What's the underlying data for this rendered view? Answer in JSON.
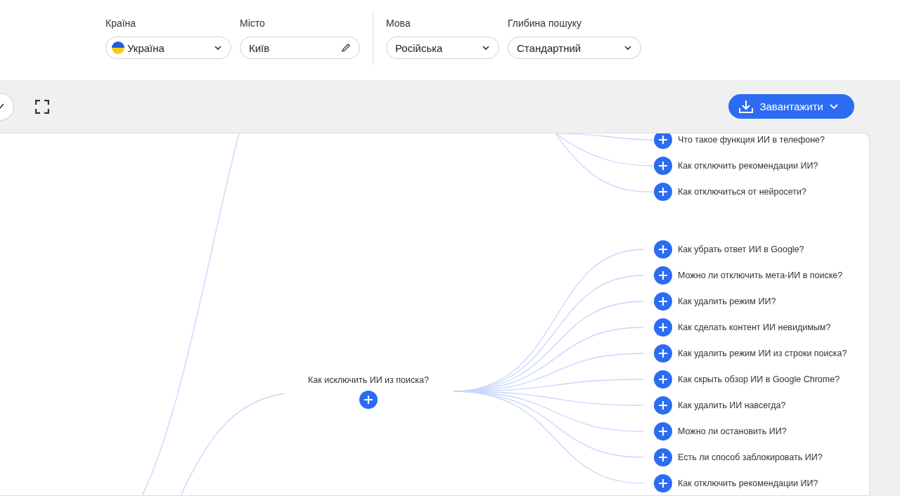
{
  "filters": [
    {
      "label": "Країна",
      "value": "Україна",
      "kind": "country"
    },
    {
      "label": "Місто",
      "value": "Київ",
      "kind": "text"
    },
    {
      "label": "Мова",
      "value": "Російська",
      "kind": "select"
    },
    {
      "label": "Глибина пошуку",
      "value": "Стандартний",
      "kind": "select"
    }
  ],
  "toolbar": {
    "download_button": "Завантажити"
  },
  "mindmap": {
    "upper_group": [
      {
        "label": "Что такое функция ИИ в телефоне?"
      },
      {
        "label": "Как отключить рекомендации ИИ?"
      },
      {
        "label": "Как отключиться от нейросети?"
      }
    ],
    "central_node": {
      "label": "Как исключить ИИ из поиска?",
      "children": [
        {
          "label": "Как убрать ответ ИИ в Google?"
        },
        {
          "label": "Можно ли отключить мета-ИИ в поиске?"
        },
        {
          "label": "Как удалить режим ИИ?"
        },
        {
          "label": "Как сделать контент ИИ невидимым?"
        },
        {
          "label": "Как удалить режим ИИ из строки поиска?"
        },
        {
          "label": "Как скрыть обзор ИИ в Google Chrome?"
        },
        {
          "label": "Как удалить ИИ навсегда?"
        },
        {
          "label": "Можно ли остановить ИИ?"
        },
        {
          "label": "Есть ли способ заблокировать ИИ?"
        },
        {
          "label": "Как отключить рекомендации ИИ?"
        }
      ]
    }
  }
}
